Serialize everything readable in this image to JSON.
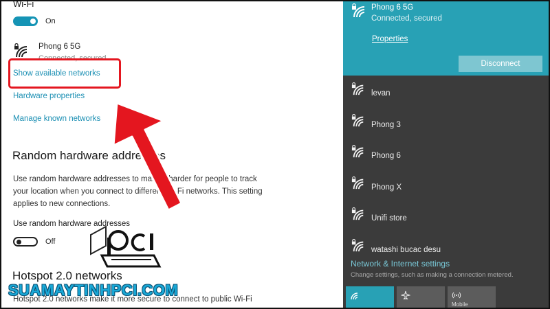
{
  "settings": {
    "wifi_heading": "Wi-Fi",
    "wifi_toggle_label": "On",
    "current_network": "Phong 6 5G",
    "current_status": "Connected, secured",
    "links": [
      "Show available networks",
      "Hardware properties",
      "Manage known networks"
    ],
    "random_section_title": "Random hardware addresses",
    "random_desc": "Use random hardware addresses to make it harder for people to track your location when you connect to different Wi-Fi networks. This setting applies to new connections.",
    "random_toggle_caption": "Use random hardware addresses",
    "random_toggle_label": "Off",
    "hotspot_title": "Hotspot 2.0 networks",
    "hotspot_desc": "Hotspot 2.0 networks make it more secure to connect to public Wi-Fi"
  },
  "flyout": {
    "connected": {
      "name": "Phong 6 5G",
      "status": "Connected, secured",
      "properties_link": "Properties",
      "disconnect_label": "Disconnect"
    },
    "networks": [
      {
        "name": "levan"
      },
      {
        "name": "Phong 3"
      },
      {
        "name": "Phong 6"
      },
      {
        "name": "Phong X"
      },
      {
        "name": "Unifi store"
      },
      {
        "name": "watashi bucac desu"
      }
    ],
    "settings_link": "Network & Internet settings",
    "settings_desc": "Change settings, such as making a connection metered.",
    "quick_actions": [
      {
        "icon": "wifi-icon",
        "label": "",
        "active": true
      },
      {
        "icon": "airplane-icon",
        "label": "",
        "active": false
      },
      {
        "icon": "mobile-hotspot-icon",
        "label": "Mobile",
        "active": false
      }
    ]
  },
  "watermark": "SUAMAYTINHPCI.COM",
  "colors": {
    "accent": "#28a1b5",
    "link": "#1b8fb3",
    "flyout_bg": "#3b3b3b",
    "highlight": "#e4161f",
    "toggle_on": "#1594b5"
  }
}
